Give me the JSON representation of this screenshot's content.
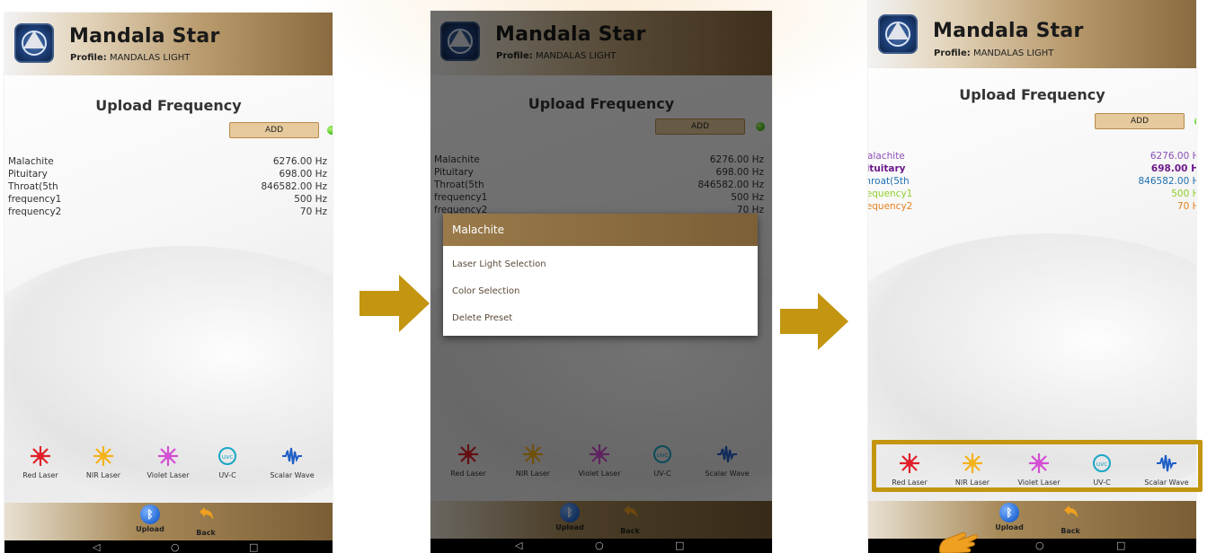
{
  "app": {
    "title": "Mandala Star",
    "profile_label": "Profile:",
    "profile_name": "MANDALAS LIGHT"
  },
  "page": {
    "title": "Upload Frequency",
    "add_label": "ADD"
  },
  "frequencies": [
    {
      "name": "Malachite",
      "value": "6276.00 Hz",
      "color": "#8b4fb8"
    },
    {
      "name": "Pituitary",
      "value": "698.00 Hz",
      "color": "#6c1a8c"
    },
    {
      "name": "Throat(5th",
      "value": "846582.00 Hz",
      "color": "#1f6fb0"
    },
    {
      "name": "frequency1",
      "value": "500 Hz",
      "color": "#8fcf2a"
    },
    {
      "name": "frequency2",
      "value": "70 Hz",
      "color": "#e5801f"
    }
  ],
  "tools": [
    {
      "label": "Red Laser",
      "icon": "red-laser-icon",
      "color": "#e0202a"
    },
    {
      "label": "NIR Laser",
      "icon": "nir-laser-icon",
      "color": "#f5b21a"
    },
    {
      "label": "Violet Laser",
      "icon": "violet-laser-icon",
      "color": "#d34fd4"
    },
    {
      "label": "UV-C",
      "icon": "uvc-icon",
      "color": "#1aa7c6"
    },
    {
      "label": "Scalar Wave",
      "icon": "scalar-wave-icon",
      "color": "#1f5ec7"
    }
  ],
  "bottom": {
    "upload_label": "Upload",
    "back_label": "Back"
  },
  "dialog": {
    "title": "Malachite",
    "items": [
      "Laser Light Selection",
      "Color Selection",
      "Delete Preset"
    ]
  },
  "colors": {
    "arrow": "#c39510",
    "highlight": "#c39510"
  }
}
